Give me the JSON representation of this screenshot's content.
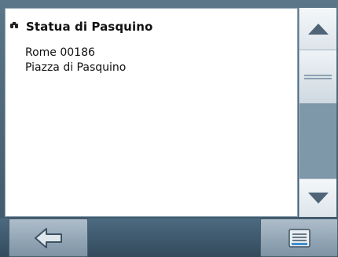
{
  "poi": {
    "name": "Statua di Pasquino",
    "icon": "binoculars-icon",
    "address_line1": "Rome 00186",
    "address_line2": "Piazza di Pasquino"
  },
  "scrollbar": {
    "up_icon": "arrow-up-icon",
    "down_icon": "arrow-down-icon",
    "position": 0.0
  },
  "toolbar": {
    "back_icon": "back-arrow-icon",
    "menu_icon": "menu-icon"
  },
  "colors": {
    "background": "#4c6678",
    "panel": "#ffffff",
    "button": "#9aabb9"
  }
}
